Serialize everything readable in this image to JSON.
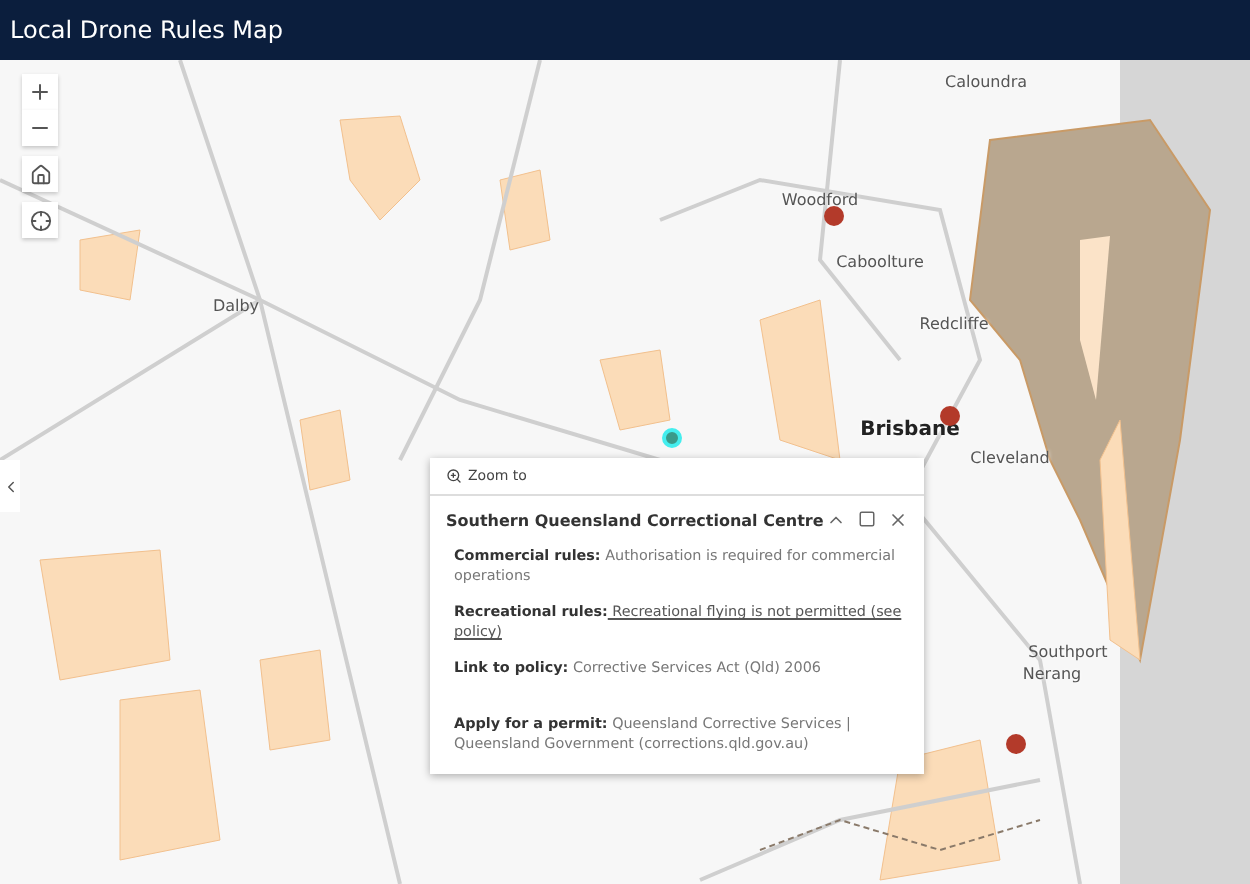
{
  "header": {
    "title": "Local Drone Rules Map"
  },
  "map_labels": [
    {
      "text": "Caloundra",
      "major": false
    },
    {
      "text": "Woodford",
      "major": false
    },
    {
      "text": "Caboolture",
      "major": false
    },
    {
      "text": "Redcliffe",
      "major": false
    },
    {
      "text": "Brisbane",
      "major": true
    },
    {
      "text": "Cleveland",
      "major": false
    },
    {
      "text": "Dalby",
      "major": false
    },
    {
      "text": "Southport",
      "major": false
    },
    {
      "text": "Nerang",
      "major": false
    }
  ],
  "popup": {
    "zoom_to": "Zoom to",
    "title": "Southern Queensland Correctional Centre",
    "fields": [
      {
        "label": "Commercial rules:",
        "value": "Authorisation is required for commercial operations",
        "link": false
      },
      {
        "label": "Recreational rules:",
        "value": " Recreational flying is not permitted (see policy)",
        "link": true
      },
      {
        "label": "Link to policy:",
        "value": "Corrective Services Act (Qld) 2006",
        "link": false
      },
      {
        "label": "Apply for a permit:",
        "value": "Queensland Corrective Services | Queensland Government (corrections.qld.gov.au)",
        "link": false
      }
    ]
  }
}
